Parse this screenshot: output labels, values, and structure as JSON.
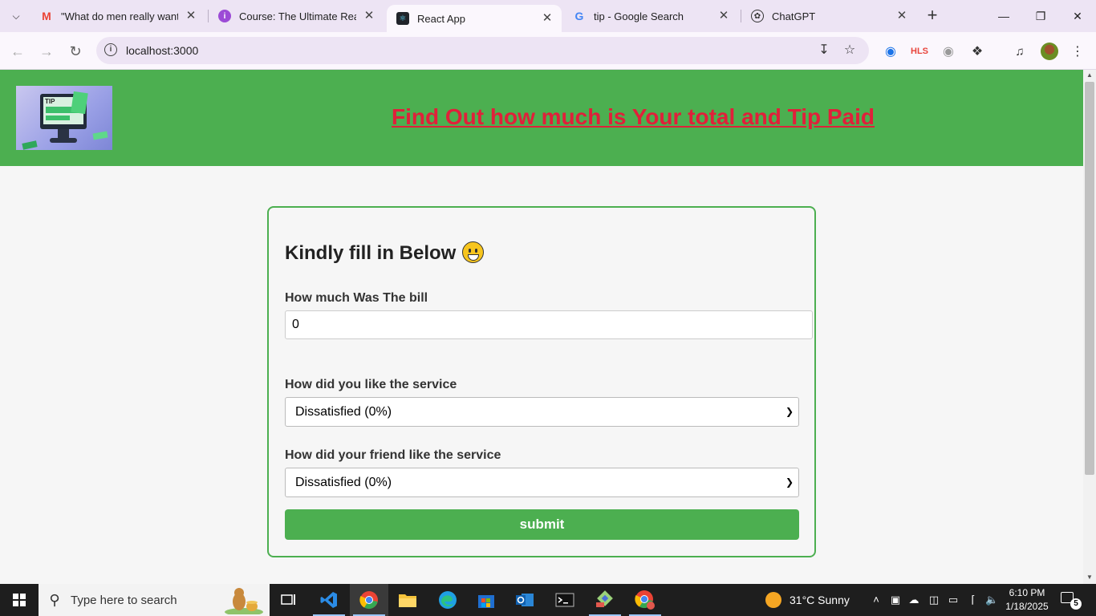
{
  "browser": {
    "tabs": [
      {
        "title": "\"What do men really want?",
        "favicon": "gmail-icon"
      },
      {
        "title": "Course: The Ultimate React C",
        "favicon": "course-icon"
      },
      {
        "title": "React App",
        "favicon": "react-icon"
      },
      {
        "title": "tip - Google Search",
        "favicon": "google-icon"
      },
      {
        "title": "ChatGPT",
        "favicon": "chatgpt-icon"
      }
    ],
    "active_tab": 2,
    "url": "localhost:3000",
    "extension_hls_label": "HLS"
  },
  "page": {
    "header_title": "Find Out how much is Your total and Tip Paid",
    "logo_text": "TIP",
    "form": {
      "heading": "Kindly fill in Below",
      "bill_label": "How much Was The bill",
      "bill_value": "0",
      "service_label": "How did you like the service",
      "service_value": "Dissatisfied (0%)",
      "friend_label": "How did your friend like the service",
      "friend_value": "Dissatisfied (0%)",
      "submit_label": "submit"
    },
    "colors": {
      "header_bg": "#4caf50",
      "title_color": "#e0203a",
      "accent": "#4caf50"
    }
  },
  "taskbar": {
    "search_placeholder": "Type here to search",
    "weather": "31°C  Sunny",
    "time": "6:10 PM",
    "date": "1/18/2025",
    "notification_count": "5"
  }
}
